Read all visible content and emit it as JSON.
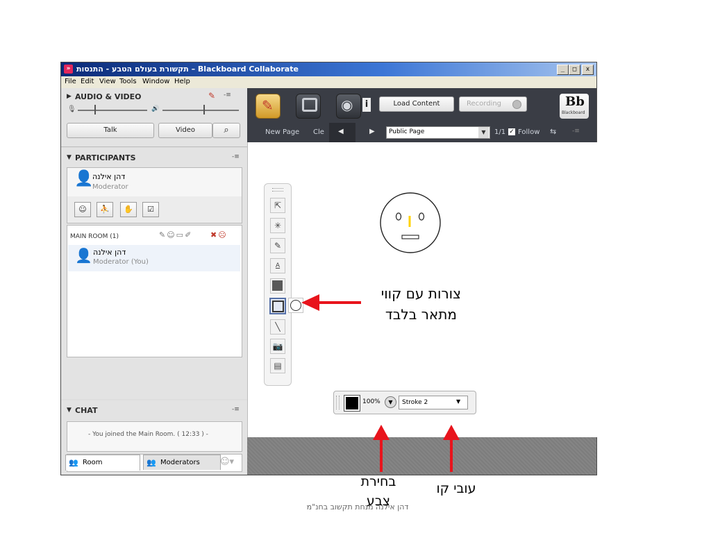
{
  "window": {
    "title": "תקשורת בעולם הטבע - התנסות – Blackboard Collaborate",
    "buttons": {
      "minimize": "_",
      "maximize": "□",
      "close": "x"
    }
  },
  "menu": [
    "File",
    "Edit",
    "View",
    "Tools",
    "Window",
    "Help"
  ],
  "audio_video": {
    "header": "AUDIO & VIDEO",
    "talk_label": "Talk",
    "video_label": "Video"
  },
  "participants": {
    "header": "PARTICIPANTS",
    "me": {
      "name": "דהן אילנה",
      "role": "Moderator"
    },
    "room": {
      "label": "MAIN ROOM (1)"
    },
    "list": [
      {
        "name": "דהן אילנה",
        "role": "Moderator (You)"
      }
    ]
  },
  "chat": {
    "header": "CHAT",
    "message": "- You joined the Main Room. ( 12:33 ) -",
    "input_placeholder": "",
    "tabs": [
      {
        "label": "Room"
      },
      {
        "label": "Moderators"
      }
    ]
  },
  "toolbar": {
    "load_content": "Load Content",
    "recording": "Recording",
    "bb_logo": "Bb",
    "bb_sub": "Blackboard",
    "info": "i"
  },
  "navbar": {
    "new_page": "New Page",
    "clear": "Cle",
    "page_select": "Public Page",
    "page_count": "1/1",
    "follow": "Follow"
  },
  "properties": {
    "opacity": "100%",
    "stroke": "Stroke 2",
    "color": "#000000"
  },
  "annotations": {
    "shapes_line1": "צורות עם קווי",
    "shapes_line2": "מתאר בלבד",
    "color_line1": "בחירת",
    "color_line2": "צבע",
    "stroke": "עובי קו",
    "footer": "דהן אילנה מנחת תקשוב בחנ\"מ"
  },
  "colors": {
    "accent_red": "#e8141c",
    "title_blue": "#0a2a78",
    "dark_bar": "#3a3d45"
  }
}
